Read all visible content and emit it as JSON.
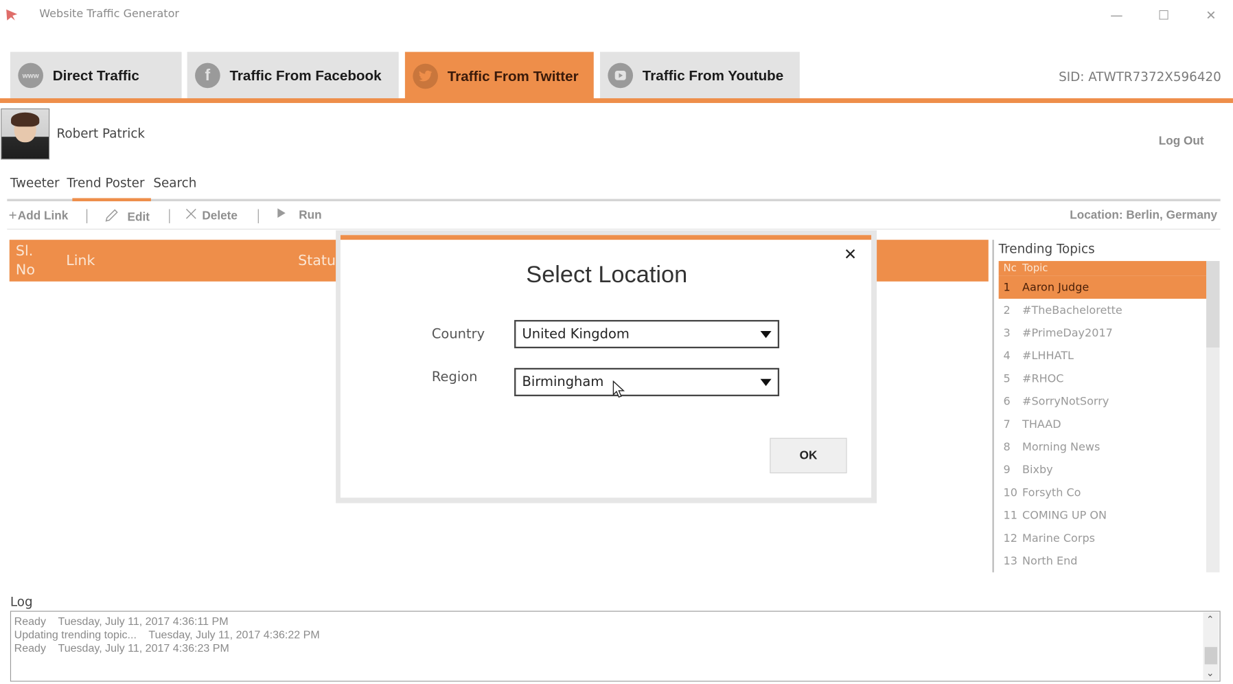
{
  "window": {
    "title": "Website Traffic Generator",
    "controls": {
      "minimize": "—",
      "maximize": "☐",
      "close": "✕"
    }
  },
  "tabs": [
    {
      "label": "Direct Traffic",
      "icon": "www-icon",
      "glyph": "www",
      "active": false
    },
    {
      "label": "Traffic From Facebook",
      "icon": "facebook-icon",
      "glyph": "f",
      "active": false
    },
    {
      "label": "Traffic From Twitter",
      "icon": "twitter-icon",
      "glyph": "🐦",
      "active": true
    },
    {
      "label": "Traffic From Youtube",
      "icon": "youtube-icon",
      "glyph": "▶",
      "active": false
    }
  ],
  "sid": "SID: ATWTR7372X596420",
  "user": {
    "name": "Robert Patrick",
    "logout": "Log Out"
  },
  "subtabs": [
    {
      "label": "Tweeter",
      "active": false
    },
    {
      "label": "Trend Poster",
      "active": true
    },
    {
      "label": "Search",
      "active": false
    }
  ],
  "toolbar": {
    "add_link": "Add Link",
    "edit": "Edit",
    "delete": "Delete",
    "run": "Run",
    "location": "Location: Berlin, Germany"
  },
  "grid": {
    "columns": {
      "sl_no_1": "Sl.",
      "sl_no_2": "No",
      "link": "Link",
      "status": "Status"
    },
    "rows": []
  },
  "trending": {
    "title": "Trending Topics",
    "header": {
      "no": "Nc",
      "topic": "Topic"
    },
    "selected_index": 0,
    "items": [
      {
        "no": "1",
        "topic": "Aaron Judge"
      },
      {
        "no": "2",
        "topic": "#TheBachelorette"
      },
      {
        "no": "3",
        "topic": "#PrimeDay2017"
      },
      {
        "no": "4",
        "topic": "#LHHATL"
      },
      {
        "no": "5",
        "topic": "#RHOC"
      },
      {
        "no": "6",
        "topic": "#SorryNotSorry"
      },
      {
        "no": "7",
        "topic": "THAAD"
      },
      {
        "no": "8",
        "topic": "Morning News"
      },
      {
        "no": "9",
        "topic": "Bixby"
      },
      {
        "no": "10",
        "topic": "Forsyth Co"
      },
      {
        "no": "11",
        "topic": "COMING UP ON"
      },
      {
        "no": "12",
        "topic": "Marine Corps"
      },
      {
        "no": "13",
        "topic": "North End"
      }
    ]
  },
  "log": {
    "label": "Log",
    "lines": [
      "Ready    Tuesday, July 11, 2017 4:36:11 PM",
      "Updating trending topic...    Tuesday, July 11, 2017 4:36:22 PM",
      "Ready    Tuesday, July 11, 2017 4:36:23 PM"
    ]
  },
  "dialog": {
    "title": "Select Location",
    "close": "✕",
    "country_label": "Country",
    "country_value": "United Kingdom",
    "region_label": "Region",
    "region_value": "Birmingham",
    "ok": "OK"
  },
  "colors": {
    "accent": "#ee8e4a",
    "tab_inactive": "#e3e3e3"
  }
}
